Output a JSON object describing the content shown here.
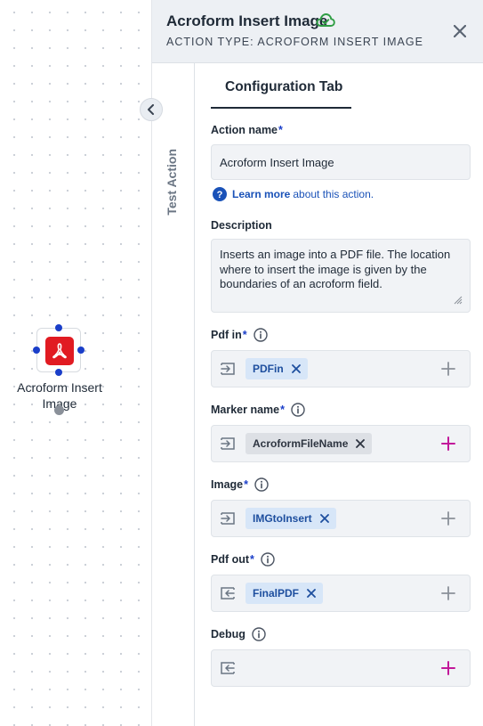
{
  "canvas": {
    "node": {
      "label": "Acroform Insert Image",
      "icon": "pdf-icon"
    }
  },
  "panel": {
    "title": "Acroform Insert Image",
    "subtitle": "ACTION TYPE: ACROFORM INSERT IMAGE",
    "side_tab": "Test Action",
    "active_tab": "Configuration Tab",
    "fields": {
      "action_name": {
        "label": "Action name",
        "required": "*",
        "value": "Acroform Insert Image"
      },
      "help": {
        "link": "Learn more",
        "rest": "about this action."
      },
      "description": {
        "label": "Description",
        "value": "Inserts an image into a PDF file. The location where to insert the image is given by the boundaries of an acroform field."
      },
      "pdf_in": {
        "label": "Pdf in",
        "required": "*",
        "chip": "PDFin"
      },
      "marker_name": {
        "label": "Marker name",
        "required": "*",
        "chip": "AcroformFileName"
      },
      "image": {
        "label": "Image",
        "required": "*",
        "chip": "IMGtoInsert"
      },
      "pdf_out": {
        "label": "Pdf out",
        "required": "*",
        "chip": "FinalPDF"
      },
      "debug": {
        "label": "Debug"
      }
    }
  },
  "colors": {
    "accent_blue": "#1a3ec9",
    "chip_blue": "#d7e6f8",
    "plus_magenta": "#c2189a",
    "cloud_green": "#2f9e44",
    "pdf_red": "#e11b22"
  }
}
